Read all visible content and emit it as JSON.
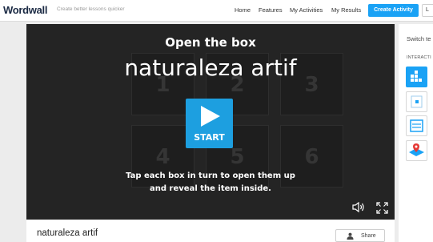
{
  "header": {
    "logo": "Wordwall",
    "tagline": "Create better lessons quicker",
    "nav": [
      "Home",
      "Features",
      "My Activities",
      "My Results"
    ],
    "create_button": "Create Activity",
    "cut_button": "L"
  },
  "game": {
    "subtitle": "Open the box",
    "title": "naturaleza artif",
    "tile_numbers": [
      "1",
      "2",
      "3",
      "4",
      "5",
      "6"
    ],
    "start_label": "START",
    "instructions": "Tap each box in turn to open them up and reveal the item inside."
  },
  "activity": {
    "title": "naturaleza artif",
    "share_label": "Share"
  },
  "side_panel": {
    "heading": "Switch te",
    "subheading": "INTERACTI",
    "templates": [
      "group-sort-icon",
      "match-up-icon",
      "quiz-icon",
      "map-pin-icon"
    ]
  },
  "colors": {
    "accent": "#1aa2f5",
    "game_bg": "#242424"
  }
}
